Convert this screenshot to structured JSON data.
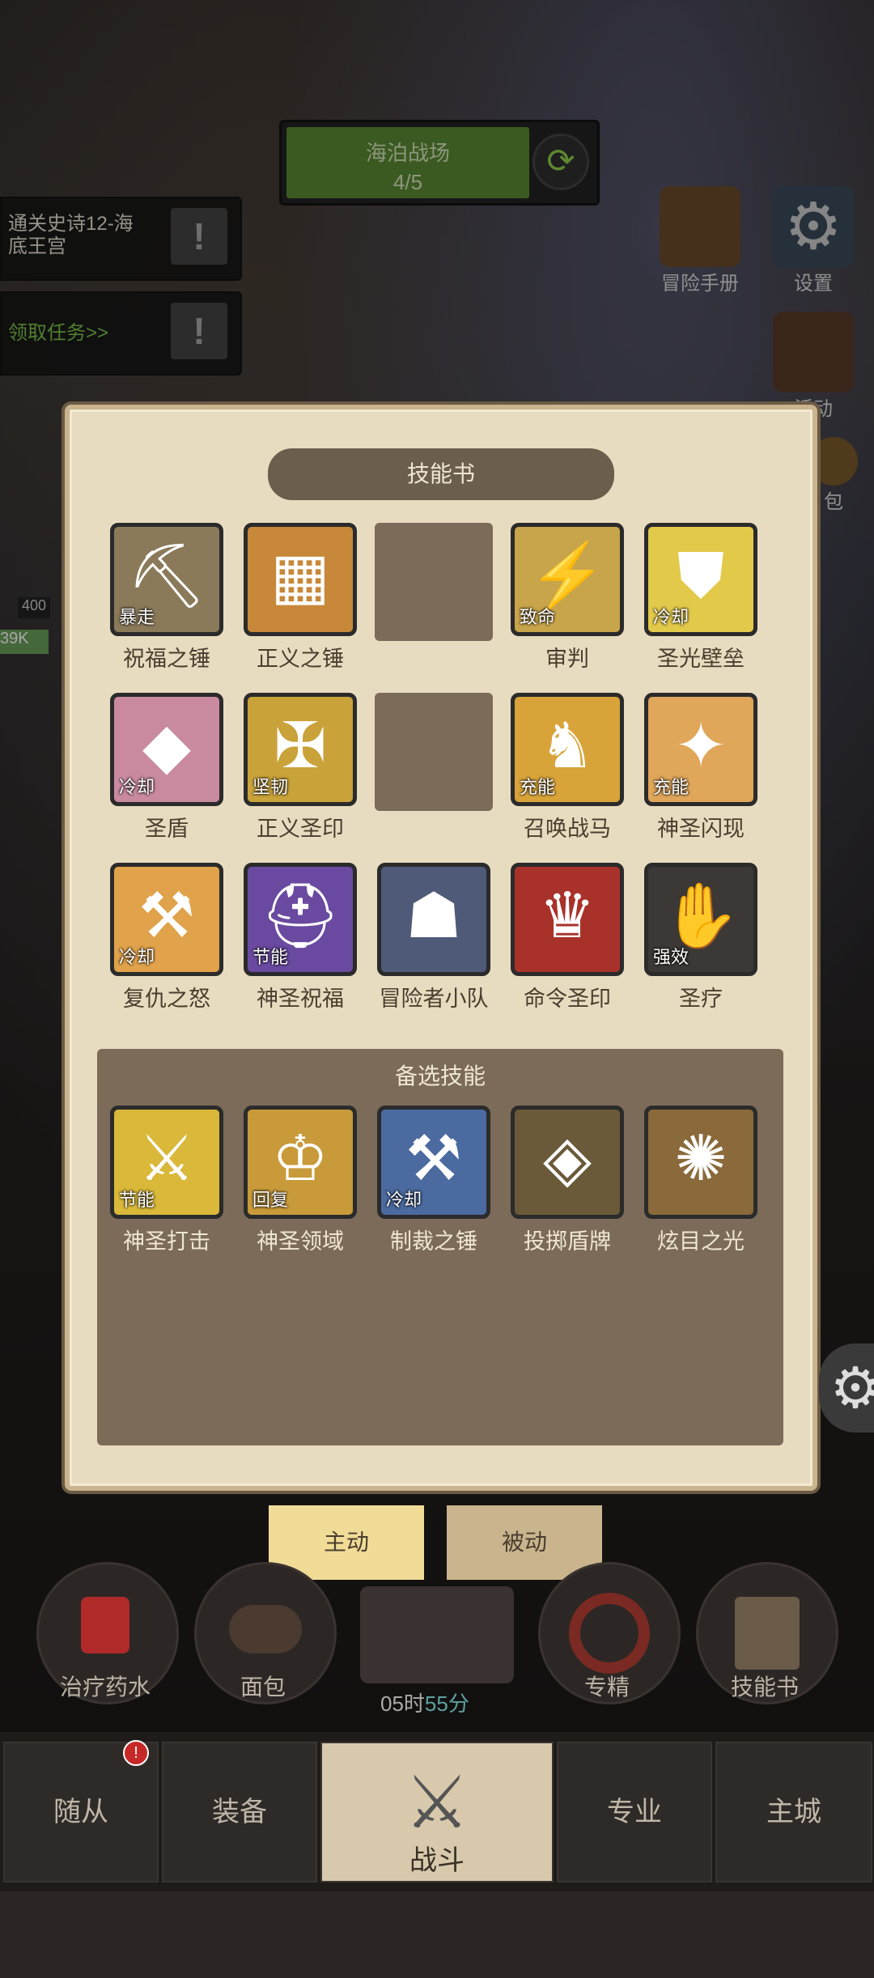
{
  "stage": {
    "name": "海泊战场",
    "progress": "4/5"
  },
  "quests": [
    {
      "text": "通关史诗12-海底王宫",
      "color": "#e6e0d2"
    },
    {
      "text": "领取任务>>",
      "color": "#7cc24a"
    }
  ],
  "side": {
    "manual": "冒险手册",
    "settings": "设置",
    "activity": "活动",
    "bag": "包"
  },
  "left_hud": {
    "level": "400",
    "hp": "39K"
  },
  "panel": {
    "title": "技能书",
    "alt_title": "备选技能",
    "rows": [
      [
        {
          "name": "祝福之锤",
          "tag": "暴走",
          "color": "#8a7a5a",
          "sym": "⛏"
        },
        {
          "name": "正义之锤",
          "tag": "",
          "color": "#c8883a",
          "sym": "▦"
        },
        null,
        {
          "name": "审判",
          "tag": "致命",
          "color": "#c8a44a",
          "sym": "⚡"
        },
        {
          "name": "圣光壁垒",
          "tag": "冷却",
          "color": "#e3c94a",
          "sym": "⛊"
        }
      ],
      [
        {
          "name": "圣盾",
          "tag": "冷却",
          "color": "#c98aa0",
          "sym": "◆"
        },
        {
          "name": "正义圣印",
          "tag": "坚韧",
          "color": "#c9a23a",
          "sym": "✠"
        },
        null,
        {
          "name": "召唤战马",
          "tag": "充能",
          "color": "#d8a43a",
          "sym": "♞"
        },
        {
          "name": "神圣闪现",
          "tag": "充能",
          "color": "#e0a65a",
          "sym": "✦"
        }
      ],
      [
        {
          "name": "复仇之怒",
          "tag": "冷却",
          "color": "#e0a24a",
          "sym": "⚒"
        },
        {
          "name": "神圣祝福",
          "tag": "节能",
          "color": "#6a4aa0",
          "sym": "⛑"
        },
        {
          "name": "冒险者小队",
          "tag": "",
          "color": "#4e5a78",
          "sym": "☗"
        },
        {
          "name": "命令圣印",
          "tag": "",
          "color": "#a8322a",
          "sym": "♛"
        },
        {
          "name": "圣疗",
          "tag": "强效",
          "color": "#3c3835",
          "sym": "✋"
        }
      ]
    ],
    "alternates": [
      {
        "name": "神圣打击",
        "tag": "节能",
        "color": "#d9b83a",
        "sym": "⚔"
      },
      {
        "name": "神圣领域",
        "tag": "回复",
        "color": "#c89a3a",
        "sym": "♔"
      },
      {
        "name": "制裁之锤",
        "tag": "冷却",
        "color": "#4a6aa0",
        "sym": "⚒"
      },
      {
        "name": "投掷盾牌",
        "tag": "",
        "color": "#6a5a3a",
        "sym": "◈"
      },
      {
        "name": "炫目之光",
        "tag": "",
        "color": "#8a6a3a",
        "sym": "✺"
      }
    ]
  },
  "tabs": {
    "active": "主动",
    "passive": "被动"
  },
  "quick": {
    "potion": "治疗药水",
    "bread": "面包",
    "spec": "专精",
    "book": "技能书"
  },
  "timer": {
    "hours": "05时",
    "minutes": "55分"
  },
  "nav": {
    "followers": "随从",
    "equipment": "装备",
    "battle": "战斗",
    "profession": "专业",
    "city": "主城"
  },
  "badge": "!"
}
